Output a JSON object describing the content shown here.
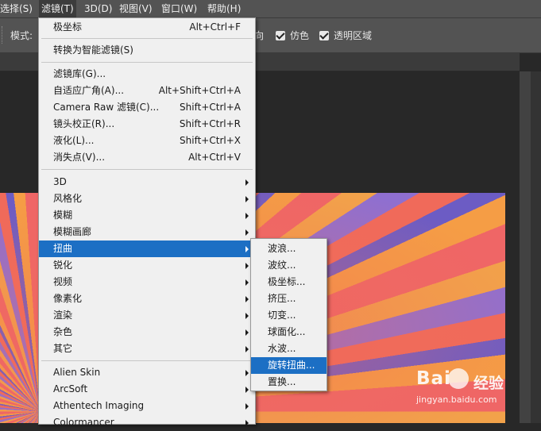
{
  "menubar": {
    "items": [
      {
        "label": "选择(S)"
      },
      {
        "label": "滤镜(T)"
      },
      {
        "label": "3D(D)"
      },
      {
        "label": "视图(V)"
      },
      {
        "label": "窗口(W)"
      },
      {
        "label": "帮助(H)"
      }
    ]
  },
  "options_bar": {
    "mode_label": "模式:",
    "partial_label": "向",
    "checkbox_dither": "仿色",
    "checkbox_transparency": "透明区域"
  },
  "filter_menu": {
    "last_filter": {
      "label": "极坐标",
      "shortcut": "Alt+Ctrl+F"
    },
    "smart_filters": {
      "label": "转换为智能滤镜(S)"
    },
    "group2": [
      {
        "label": "滤镜库(G)...",
        "shortcut": ""
      },
      {
        "label": "自适应广角(A)...",
        "shortcut": "Alt+Shift+Ctrl+A"
      },
      {
        "label": "Camera Raw 滤镜(C)...",
        "shortcut": "Shift+Ctrl+A"
      },
      {
        "label": "镜头校正(R)...",
        "shortcut": "Shift+Ctrl+R"
      },
      {
        "label": "液化(L)...",
        "shortcut": "Shift+Ctrl+X"
      },
      {
        "label": "消失点(V)...",
        "shortcut": "Alt+Ctrl+V"
      }
    ],
    "group3": [
      {
        "label": "3D"
      },
      {
        "label": "风格化"
      },
      {
        "label": "模糊"
      },
      {
        "label": "模糊画廊"
      },
      {
        "label": "扭曲"
      },
      {
        "label": "锐化"
      },
      {
        "label": "视频"
      },
      {
        "label": "像素化"
      },
      {
        "label": "渲染"
      },
      {
        "label": "杂色"
      },
      {
        "label": "其它"
      }
    ],
    "group4": [
      {
        "label": "Alien Skin"
      },
      {
        "label": "ArcSoft"
      },
      {
        "label": "Athentech Imaging"
      },
      {
        "label": "Colormancer"
      }
    ]
  },
  "distort_submenu": {
    "items": [
      {
        "label": "波浪..."
      },
      {
        "label": "波纹..."
      },
      {
        "label": "极坐标..."
      },
      {
        "label": "挤压..."
      },
      {
        "label": "切变..."
      },
      {
        "label": "球面化..."
      },
      {
        "label": "水波..."
      },
      {
        "label": "旋转扭曲..."
      },
      {
        "label": "置换..."
      }
    ]
  },
  "watermark": {
    "logo": "Bai",
    "brand": "经验",
    "url": "jingyan.baidu.com"
  },
  "colors": {
    "menu_highlight": "#1c6fc4",
    "menu_background": "#f0f0f0",
    "chrome": "#535353"
  }
}
